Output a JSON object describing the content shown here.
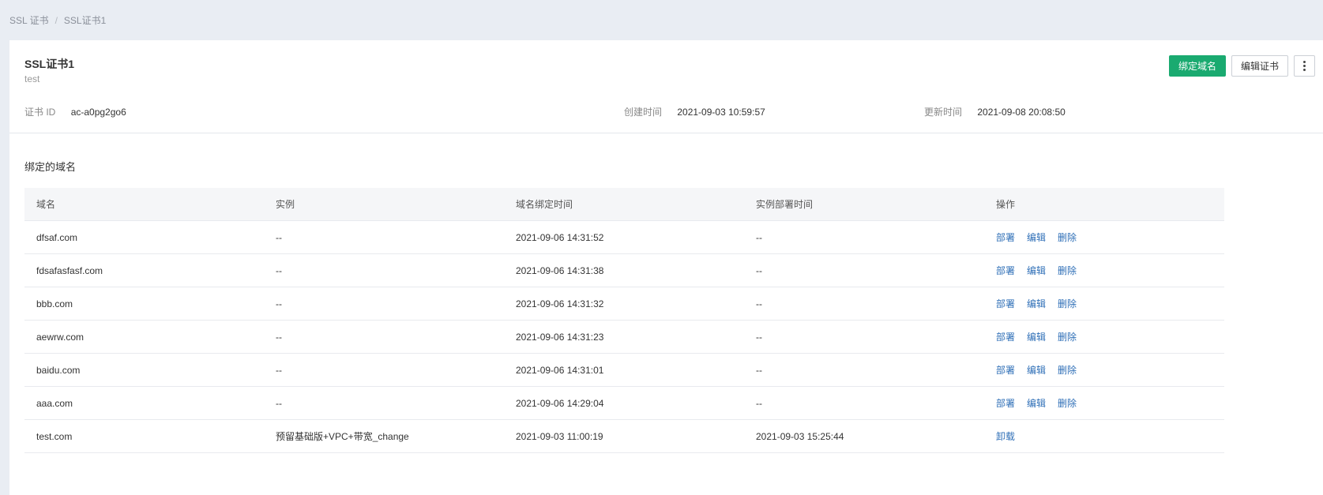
{
  "breadcrumb": {
    "root": "SSL 证书",
    "current": "SSL证书1",
    "separator": "/"
  },
  "cert": {
    "title": "SSL证书1",
    "subtitle": "test"
  },
  "actions": {
    "bind_domain": "绑定域名",
    "edit_cert": "编辑证书"
  },
  "meta": {
    "id_label": "证书 ID",
    "id_value": "ac-a0pg2go6",
    "created_label": "创建时间",
    "created_value": "2021-09-03 10:59:57",
    "updated_label": "更新时间",
    "updated_value": "2021-09-08 20:08:50"
  },
  "section_title": "绑定的域名",
  "table": {
    "headers": [
      "域名",
      "实例",
      "域名绑定时间",
      "实例部署时间",
      "操作"
    ],
    "rows": [
      {
        "domain": "dfsaf.com",
        "instance": "--",
        "bind_time": "2021-09-06 14:31:52",
        "deploy_time": "--",
        "ops": [
          "部署",
          "编辑",
          "删除"
        ]
      },
      {
        "domain": "fdsafasfasf.com",
        "instance": "--",
        "bind_time": "2021-09-06 14:31:38",
        "deploy_time": "--",
        "ops": [
          "部署",
          "编辑",
          "删除"
        ]
      },
      {
        "domain": "bbb.com",
        "instance": "--",
        "bind_time": "2021-09-06 14:31:32",
        "deploy_time": "--",
        "ops": [
          "部署",
          "编辑",
          "删除"
        ]
      },
      {
        "domain": "aewrw.com",
        "instance": "--",
        "bind_time": "2021-09-06 14:31:23",
        "deploy_time": "--",
        "ops": [
          "部署",
          "编辑",
          "删除"
        ]
      },
      {
        "domain": "baidu.com",
        "instance": "--",
        "bind_time": "2021-09-06 14:31:01",
        "deploy_time": "--",
        "ops": [
          "部署",
          "编辑",
          "删除"
        ]
      },
      {
        "domain": "aaa.com",
        "instance": "--",
        "bind_time": "2021-09-06 14:29:04",
        "deploy_time": "--",
        "ops": [
          "部署",
          "编辑",
          "删除"
        ]
      },
      {
        "domain": "test.com",
        "instance": "预留基础版+VPC+带宽_change",
        "bind_time": "2021-09-03 11:00:19",
        "deploy_time": "2021-09-03 15:25:44",
        "ops": [
          "卸载"
        ]
      }
    ]
  },
  "colors": {
    "primary": "#1aaa70",
    "link": "#2f6fb7",
    "page_bg": "#e9edf3"
  },
  "icons": {
    "more": "more-vertical-icon"
  }
}
